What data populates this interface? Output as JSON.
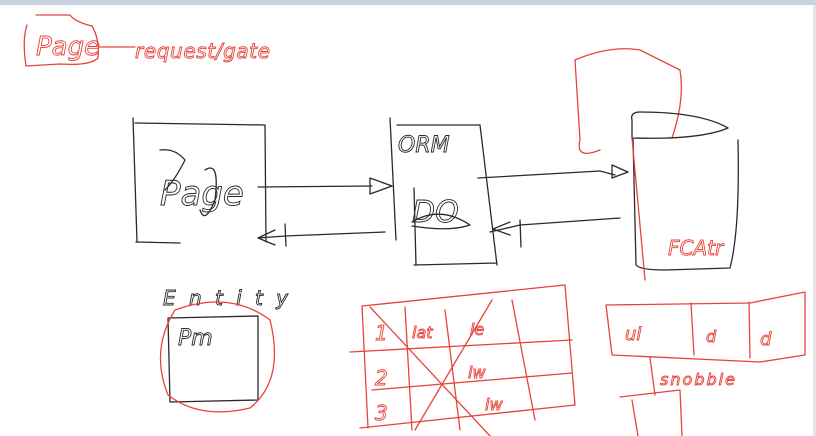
{
  "colors": {
    "ink_black": "#2a2a2a",
    "ink_red": "#e8433a",
    "toolbar": "#c9d3e0"
  },
  "labels": {
    "page_top": "Page",
    "request_gate": "request/gate",
    "page_box": "Page",
    "orm": "ORM",
    "dom": "DO",
    "db": "FCAtr",
    "entity": "Entity",
    "pm": "Pm",
    "row_1": "1",
    "row_2": "2",
    "row_3": "3",
    "cell_1": "lat",
    "cell_2": "le",
    "cell_3": "lw",
    "cell_4": "lw",
    "right_cell_1": "ul",
    "right_cell_2": "d",
    "right_cell_3": "d",
    "snobble": "snobble"
  }
}
